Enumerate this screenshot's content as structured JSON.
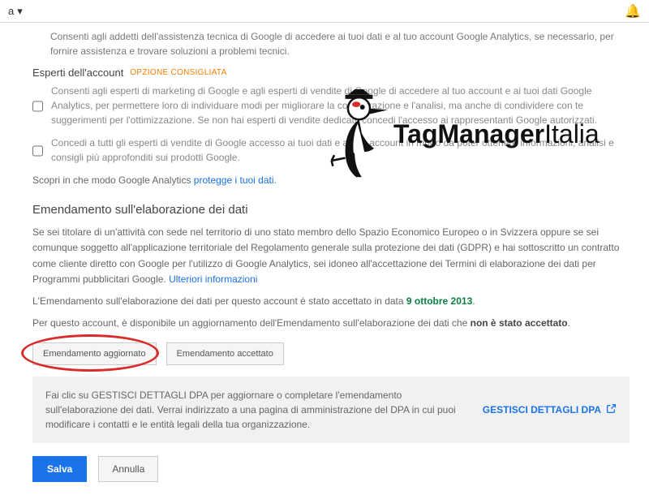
{
  "topbar": {
    "left_fragment": "a"
  },
  "intro": {
    "tech_support": "Consenti agli addetti dell'assistenza tecnica di Google di accedere ai tuoi dati e al tuo account Google Analytics, se necessario, per fornire assistenza e trovare soluzioni a problemi tecnici."
  },
  "experts": {
    "title": "Esperti dell'account",
    "badge": "OPZIONE CONSIGLIATA",
    "opt1": "Consenti agli esperti di marketing di Google e agli esperti di vendite di Google di accedere al tuo account e ai tuoi dati Google Analytics, per permettere loro di individuare modi per migliorare la configurazione e l'analisi, ma anche di condividere con te suggerimenti per l'ottimizzazione. Se non hai esperti di vendite dedicati, concedi l'accesso ai rappresentanti Google autorizzati.",
    "opt2": "Concedi a tutti gli esperti di vendite di Google accesso ai tuoi dati e al tuo account in modo da poter ottenere informazioni, analisi e consigli più approfonditi sui prodotti Google."
  },
  "protect": {
    "prefix": "Scopri in che modo Google Analytics ",
    "link": "protegge i tuoi dati",
    "suffix": "."
  },
  "amendment": {
    "heading": "Emendamento sull'elaborazione dei dati",
    "p1_a": "Se sei titolare di un'attività con sede nel territorio di uno stato membro dello Spazio Economico Europeo o in Svizzera oppure se sei comunque soggetto all'applicazione territoriale del Regolamento generale sulla protezione dei dati (GDPR) e hai sottoscritto un contratto come cliente diretto con Google per l'utilizzo di Google Analytics, sei idoneo all'accettazione dei Termini di elaborazione dei dati per Programmi pubblicitari Google. ",
    "p1_link": "Ulteriori informazioni",
    "p2_a": "L'Emendamento sull'elaborazione dei dati per questo account è stato accettato in data ",
    "p2_date": "9 ottobre 2013",
    "p3_a": "Per questo account, è disponibile un aggiornamento dell'Emendamento sull'elaborazione dei dati che ",
    "p3_strong": "non è stato accettato",
    "btn_updated": "Emendamento aggiornato",
    "btn_accepted": "Emendamento accettato"
  },
  "callout": {
    "text": "Fai clic su GESTISCI DETTAGLI DPA per aggiornare o completare l'emendamento sull'elaborazione dei dati. Verrai indirizzato a una pagina di amministrazione del DPA in cui puoi modificare i contatti e le entità legali della tua organizzazione.",
    "manage": "GESTISCI DETTAGLI DPA"
  },
  "actions": {
    "save": "Salva",
    "cancel": "Annulla"
  },
  "overlay": {
    "brand_a": "TagManager",
    "brand_b": "Italia"
  }
}
